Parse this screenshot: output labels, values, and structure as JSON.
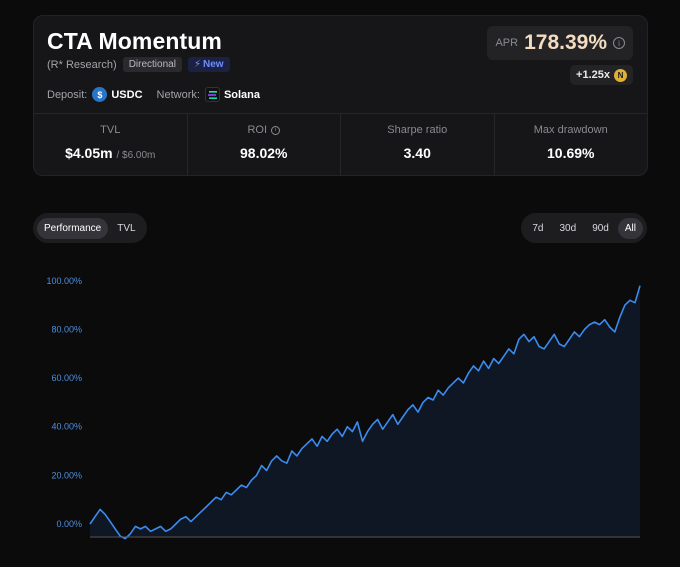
{
  "vault": {
    "title": "CTA Momentum",
    "manager": "(R* Research)",
    "tag_directional": "Directional",
    "tag_new": "New",
    "deposit_label": "Deposit:",
    "deposit_asset": "USDC",
    "network_label": "Network:",
    "network_name": "Solana"
  },
  "apr": {
    "label": "APR",
    "value": "178.39%",
    "boost": "+1.25x"
  },
  "stats": {
    "tvl_label": "TVL",
    "tvl_value": "$4.05m",
    "tvl_cap": "/ $6.00m",
    "roi_label": "ROI",
    "roi_value": "98.02%",
    "sharpe_label": "Sharpe ratio",
    "sharpe_value": "3.40",
    "dd_label": "Max drawdown",
    "dd_value": "10.69%"
  },
  "tabs": {
    "performance": "Performance",
    "tvl": "TVL"
  },
  "ranges": {
    "d7": "7d",
    "d30": "30d",
    "d90": "90d",
    "all": "All"
  },
  "colors": {
    "accent_line": "#3b8cf0",
    "apr_value": "#f3dcc0",
    "new_tag": "#6f8dff"
  },
  "chart_data": {
    "type": "area",
    "ylim": [
      -5,
      105
    ],
    "yticks": [
      "0.00%",
      "20.00%",
      "40.00%",
      "60.00%",
      "80.00%",
      "100.00%"
    ],
    "ytick_values": [
      0,
      20,
      40,
      60,
      80,
      100
    ],
    "values": [
      0,
      3,
      6,
      4,
      1,
      -2,
      -5,
      -6,
      -4,
      -1,
      -2,
      -1,
      -3,
      -2,
      -1,
      -3,
      -2,
      0,
      2,
      3,
      1,
      3,
      5,
      7,
      9,
      11,
      10,
      13,
      12,
      14,
      16,
      15,
      18,
      20,
      24,
      22,
      26,
      28,
      26,
      25,
      30,
      28,
      31,
      33,
      35,
      32,
      36,
      34,
      37,
      39,
      36,
      40,
      38,
      42,
      34,
      38,
      41,
      43,
      39,
      42,
      45,
      41,
      44,
      47,
      49,
      46,
      50,
      52,
      51,
      55,
      53,
      56,
      58,
      60,
      58,
      62,
      65,
      63,
      67,
      64,
      68,
      66,
      69,
      72,
      70,
      76,
      78,
      75,
      77,
      73,
      72,
      75,
      78,
      74,
      73,
      76,
      79,
      77,
      80,
      82,
      83,
      82,
      84,
      81,
      79,
      85,
      90,
      92,
      91,
      98
    ]
  }
}
